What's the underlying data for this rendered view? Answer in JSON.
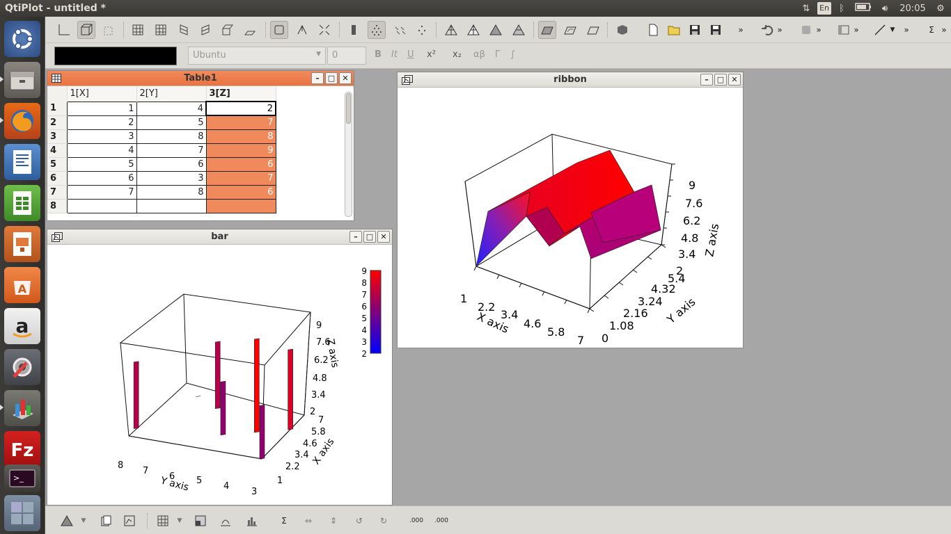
{
  "topbar": {
    "title": "QtiPlot - untitled *",
    "keyboard_layout": "En",
    "clock": "20:05"
  },
  "launcher": [
    {
      "name": "ubuntu-dash-icon"
    },
    {
      "name": "file-manager-icon"
    },
    {
      "name": "firefox-icon"
    },
    {
      "name": "writer-icon"
    },
    {
      "name": "calc-icon"
    },
    {
      "name": "impress-icon"
    },
    {
      "name": "software-center-icon"
    },
    {
      "name": "amazon-icon"
    },
    {
      "name": "system-settings-icon"
    },
    {
      "name": "qtiplot-icon"
    },
    {
      "name": "filezilla-icon"
    },
    {
      "name": "terminal-icon"
    },
    {
      "name": "workspace-switcher-icon"
    }
  ],
  "format_bar": {
    "font": "Ubuntu",
    "font_size": "0",
    "bold": "B",
    "italic": "It",
    "underline": "U",
    "superscript": "x²",
    "subscript": "x₂",
    "greek": "αβ",
    "greek_upper": "Γ",
    "integral": "∫"
  },
  "table1": {
    "title": "Table1",
    "columns": [
      "1[X]",
      "2[Y]",
      "3[Z]"
    ],
    "rows": [
      {
        "n": "1",
        "x": "1",
        "y": "4",
        "z": "2"
      },
      {
        "n": "2",
        "x": "2",
        "y": "5",
        "z": "7"
      },
      {
        "n": "3",
        "x": "3",
        "y": "8",
        "z": "8"
      },
      {
        "n": "4",
        "x": "4",
        "y": "7",
        "z": "9"
      },
      {
        "n": "5",
        "x": "5",
        "y": "6",
        "z": "6"
      },
      {
        "n": "6",
        "x": "6",
        "y": "3",
        "z": "7"
      },
      {
        "n": "7",
        "x": "7",
        "y": "8",
        "z": "6"
      },
      {
        "n": "8",
        "x": "",
        "y": "",
        "z": ""
      }
    ]
  },
  "ribbon": {
    "title": "ribbon",
    "z_ticks": [
      "9",
      "7.6",
      "6.2",
      "4.8",
      "3.4",
      "2"
    ],
    "y_ticks": [
      "5.4",
      "4.32",
      "3.24",
      "2.16",
      "1.08",
      "0"
    ],
    "x_ticks": [
      "1",
      "2.2",
      "3.4",
      "4.6",
      "5.8",
      "7"
    ],
    "x_label": "X axis",
    "y_label": "Y axis",
    "z_label": "Z axis"
  },
  "bar": {
    "title": "bar",
    "legend_ticks": [
      "9",
      "8",
      "7",
      "6",
      "5",
      "4",
      "3",
      "2"
    ],
    "z_ticks": [
      "9",
      "7.6",
      "6.2",
      "4.8",
      "3.4",
      "2"
    ],
    "x_ticks": [
      "7",
      "5.8",
      "4.6",
      "3.4",
      "2.2",
      "1"
    ],
    "y_ticks": [
      "8",
      "7",
      "6",
      "5",
      "4",
      "3"
    ],
    "x_label": "X axis",
    "y_label": "Y axis",
    "z_label": "Z axis"
  },
  "chart_data": [
    {
      "type": "ribbon-3d",
      "title": "ribbon",
      "x": [
        1,
        2,
        3,
        4,
        5,
        6,
        7
      ],
      "y": [
        4,
        5,
        8,
        7,
        6,
        3,
        8
      ],
      "z": [
        2,
        7,
        8,
        9,
        6,
        7,
        6
      ],
      "xlabel": "X axis",
      "ylabel": "Y axis",
      "zlabel": "Z axis",
      "xlim": [
        1,
        7
      ],
      "ylim": [
        0,
        5.4
      ],
      "zlim": [
        2,
        9
      ]
    },
    {
      "type": "bar-3d",
      "title": "bar",
      "x": [
        1,
        2,
        3,
        4,
        5,
        6,
        7
      ],
      "y": [
        4,
        5,
        8,
        7,
        6,
        3,
        8
      ],
      "z": [
        2,
        7,
        8,
        9,
        6,
        7,
        6
      ],
      "xlabel": "X axis",
      "ylabel": "Y axis",
      "zlabel": "Z axis",
      "colormap": [
        "#0000ff",
        "#ff0000"
      ],
      "legend_range": [
        2,
        9
      ]
    }
  ]
}
